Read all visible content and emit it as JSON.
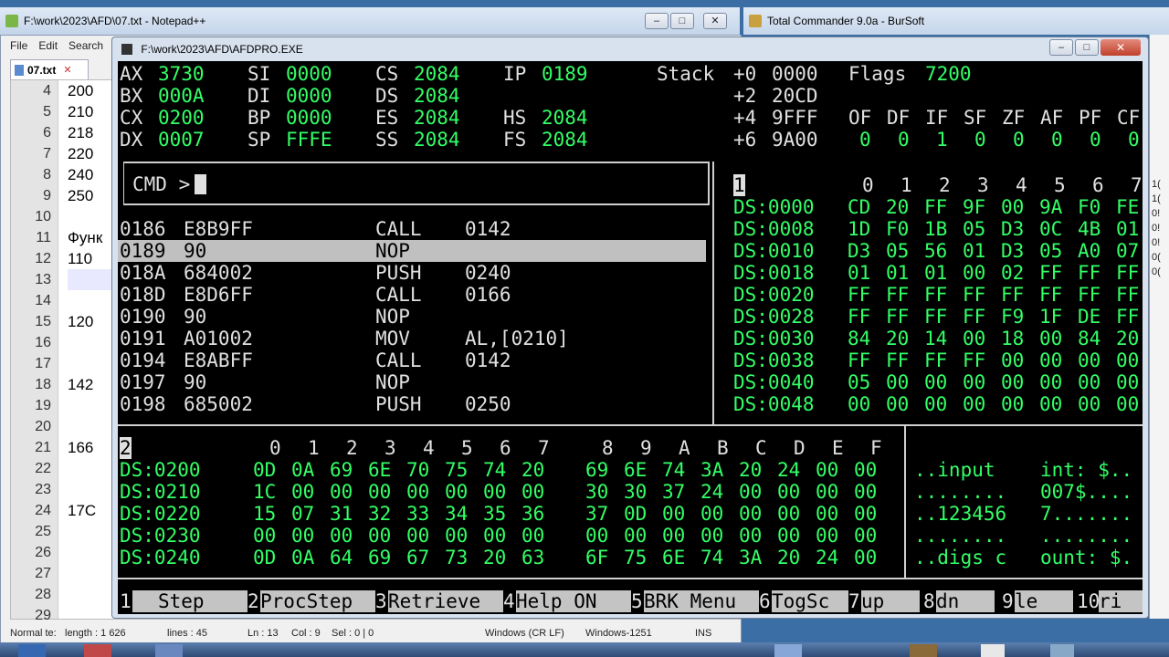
{
  "taskbar_top": {
    "notepad_title": "F:\\work\\2023\\AFD\\07.txt - Notepad++",
    "tc_title": "Total Commander 9.0a - BurSoft"
  },
  "notepad": {
    "menu": [
      "File",
      "Edit",
      "Search"
    ],
    "tab": "07.txt",
    "line_numbers": [
      "4",
      "5",
      "6",
      "7",
      "8",
      "9",
      "10",
      "11",
      "12",
      "13",
      "14",
      "15",
      "16",
      "17",
      "18",
      "19",
      "20",
      "21",
      "22",
      "23",
      "24",
      "25",
      "26",
      "27",
      "28",
      "29"
    ],
    "line_texts": {
      "4": "200",
      "5": "210",
      "6": "218",
      "7": "220",
      "8": "240",
      "9": "250",
      "11": "Функ",
      "12": "110",
      "15": "120",
      "18": "142",
      "21": "166",
      "24": "17C"
    },
    "status": {
      "type": "Normal te:",
      "length": "length : 1 626",
      "lines": "lines : 45",
      "ln": "Ln : 13",
      "col": "Col : 9",
      "sel": "Sel : 0 | 0",
      "eol": "Windows (CR LF)",
      "enc": "Windows-1251",
      "mode": "INS"
    }
  },
  "tc_right_digits": [
    "1(",
    "1(",
    "0!",
    "0!",
    "0!",
    "0(",
    "0("
  ],
  "afd": {
    "title": "F:\\work\\2023\\AFD\\AFDPRO.EXE",
    "registers": [
      {
        "n": "AX",
        "v": "3730"
      },
      {
        "n": "SI",
        "v": "0000"
      },
      {
        "n": "CS",
        "v": "2084"
      },
      {
        "n": "IP",
        "v": "0189"
      },
      {
        "n": "BX",
        "v": "000A"
      },
      {
        "n": "DI",
        "v": "0000"
      },
      {
        "n": "DS",
        "v": "2084"
      },
      {
        "n": "CX",
        "v": "0200"
      },
      {
        "n": "BP",
        "v": "0000"
      },
      {
        "n": "ES",
        "v": "2084"
      },
      {
        "n": "HS",
        "v": "2084"
      },
      {
        "n": "DX",
        "v": "0007"
      },
      {
        "n": "SP",
        "v": "FFFE"
      },
      {
        "n": "SS",
        "v": "2084"
      },
      {
        "n": "FS",
        "v": "2084"
      }
    ],
    "stack_label": "Stack",
    "stack": [
      {
        "off": "+0",
        "v": "0000"
      },
      {
        "off": "+2",
        "v": "20CD"
      },
      {
        "off": "+4",
        "v": "9FFF"
      },
      {
        "off": "+6",
        "v": "9A00"
      }
    ],
    "flags_label": "Flags",
    "flags_value": "7200",
    "flag_names": [
      "OF",
      "DF",
      "IF",
      "SF",
      "ZF",
      "AF",
      "PF",
      "CF"
    ],
    "flag_values": [
      "0",
      "0",
      "1",
      "0",
      "0",
      "0",
      "0",
      "0"
    ],
    "cmd_prompt": "CMD >",
    "disasm": [
      {
        "addr": "0186",
        "hex": "E8B9FF",
        "op": "CALL",
        "arg": "0142"
      },
      {
        "addr": "0189",
        "hex": "90",
        "op": "NOP",
        "arg": ""
      },
      {
        "addr": "018A",
        "hex": "684002",
        "op": "PUSH",
        "arg": "0240"
      },
      {
        "addr": "018D",
        "hex": "E8D6FF",
        "op": "CALL",
        "arg": "0166"
      },
      {
        "addr": "0190",
        "hex": "90",
        "op": "NOP",
        "arg": ""
      },
      {
        "addr": "0191",
        "hex": "A01002",
        "op": "MOV",
        "arg": "AL,[0210]"
      },
      {
        "addr": "0194",
        "hex": "E8ABFF",
        "op": "CALL",
        "arg": "0142"
      },
      {
        "addr": "0197",
        "hex": "90",
        "op": "NOP",
        "arg": ""
      },
      {
        "addr": "0198",
        "hex": "685002",
        "op": "PUSH",
        "arg": "0250"
      }
    ],
    "mem1": {
      "id": "1",
      "cols": [
        "0",
        "1",
        "2",
        "3",
        "4",
        "5",
        "6",
        "7"
      ],
      "rows": [
        {
          "a": "DS:0000",
          "b": [
            "CD",
            "20",
            "FF",
            "9F",
            "00",
            "9A",
            "F0",
            "FE"
          ]
        },
        {
          "a": "DS:0008",
          "b": [
            "1D",
            "F0",
            "1B",
            "05",
            "D3",
            "0C",
            "4B",
            "01"
          ]
        },
        {
          "a": "DS:0010",
          "b": [
            "D3",
            "05",
            "56",
            "01",
            "D3",
            "05",
            "A0",
            "07"
          ]
        },
        {
          "a": "DS:0018",
          "b": [
            "01",
            "01",
            "01",
            "00",
            "02",
            "FF",
            "FF",
            "FF"
          ]
        },
        {
          "a": "DS:0020",
          "b": [
            "FF",
            "FF",
            "FF",
            "FF",
            "FF",
            "FF",
            "FF",
            "FF"
          ]
        },
        {
          "a": "DS:0028",
          "b": [
            "FF",
            "FF",
            "FF",
            "FF",
            "F9",
            "1F",
            "DE",
            "FF"
          ]
        },
        {
          "a": "DS:0030",
          "b": [
            "84",
            "20",
            "14",
            "00",
            "18",
            "00",
            "84",
            "20"
          ]
        },
        {
          "a": "DS:0038",
          "b": [
            "FF",
            "FF",
            "FF",
            "FF",
            "00",
            "00",
            "00",
            "00"
          ]
        },
        {
          "a": "DS:0040",
          "b": [
            "05",
            "00",
            "00",
            "00",
            "00",
            "00",
            "00",
            "00"
          ]
        },
        {
          "a": "DS:0048",
          "b": [
            "00",
            "00",
            "00",
            "00",
            "00",
            "00",
            "00",
            "00"
          ]
        }
      ]
    },
    "mem2": {
      "id": "2",
      "cols": [
        "0",
        "1",
        "2",
        "3",
        "4",
        "5",
        "6",
        "7",
        "8",
        "9",
        "A",
        "B",
        "C",
        "D",
        "E",
        "F"
      ],
      "rows": [
        {
          "a": "DS:0200",
          "b": [
            "0D",
            "0A",
            "69",
            "6E",
            "70",
            "75",
            "74",
            "20",
            "69",
            "6E",
            "74",
            "3A",
            "20",
            "24",
            "00",
            "00"
          ],
          "t1": "..input ",
          "t2": "int: $.."
        },
        {
          "a": "DS:0210",
          "b": [
            "1C",
            "00",
            "00",
            "00",
            "00",
            "00",
            "00",
            "00",
            "30",
            "30",
            "37",
            "24",
            "00",
            "00",
            "00",
            "00"
          ],
          "t1": "........",
          "t2": "007$...."
        },
        {
          "a": "DS:0220",
          "b": [
            "15",
            "07",
            "31",
            "32",
            "33",
            "34",
            "35",
            "36",
            "37",
            "0D",
            "00",
            "00",
            "00",
            "00",
            "00",
            "00"
          ],
          "t1": "..123456",
          "t2": "7......."
        },
        {
          "a": "DS:0230",
          "b": [
            "00",
            "00",
            "00",
            "00",
            "00",
            "00",
            "00",
            "00",
            "00",
            "00",
            "00",
            "00",
            "00",
            "00",
            "00",
            "00"
          ],
          "t1": "........",
          "t2": "........"
        },
        {
          "a": "DS:0240",
          "b": [
            "0D",
            "0A",
            "64",
            "69",
            "67",
            "73",
            "20",
            "63",
            "6F",
            "75",
            "6E",
            "74",
            "3A",
            "20",
            "24",
            "00"
          ],
          "t1": "..digs c",
          "t2": "ount: $."
        }
      ]
    },
    "fkeys": [
      {
        "n": "1",
        "l": "Step"
      },
      {
        "n": "2",
        "l": "ProcStep"
      },
      {
        "n": "3",
        "l": "Retrieve"
      },
      {
        "n": "4",
        "l": "Help ON"
      },
      {
        "n": "5",
        "l": "BRK Menu"
      },
      {
        "n": "6",
        "l": "TogSc"
      },
      {
        "n": "7",
        "l": "up"
      },
      {
        "n": "8",
        "l": "dn"
      },
      {
        "n": "9",
        "l": "le"
      },
      {
        "n": "10",
        "l": "ri"
      }
    ]
  }
}
